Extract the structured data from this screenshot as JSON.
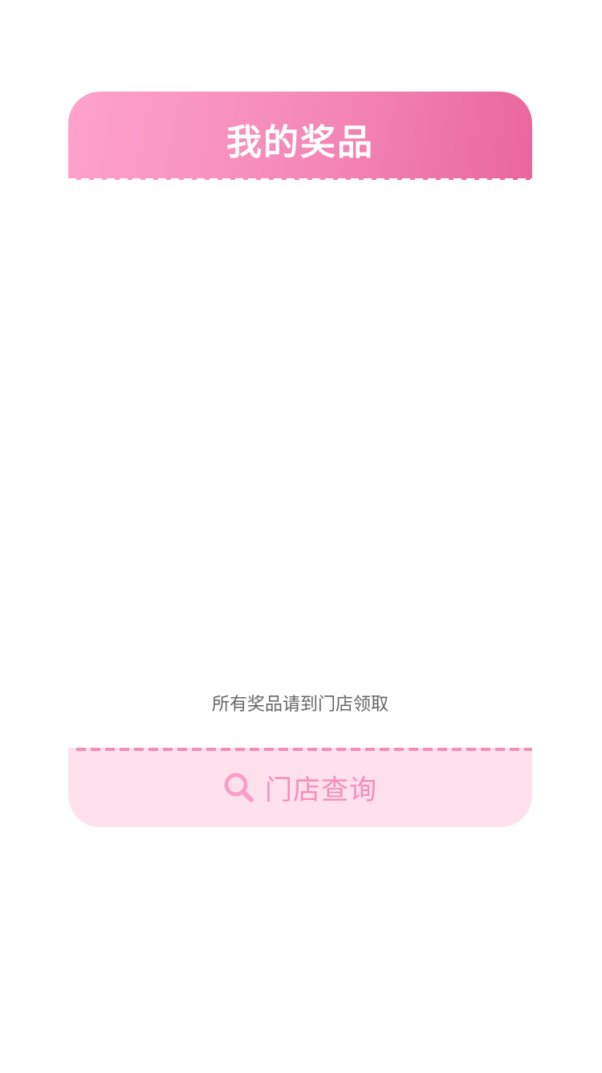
{
  "header": {
    "title": "我的奖品"
  },
  "notice": {
    "text": "所有奖品请到门店领取"
  },
  "footer": {
    "store_button_label": "门店查询",
    "store_button_icon": "search-icon"
  },
  "colors": {
    "header_gradient_start": "#fea2cc",
    "header_gradient_end": "#e8669e",
    "footer_background": "#ffe1ee",
    "accent_pink": "#f68ebc",
    "notice_text": "#666666"
  }
}
